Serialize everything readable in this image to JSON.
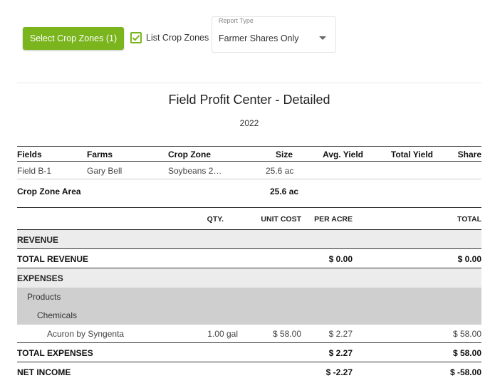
{
  "toolbar": {
    "select_button_label": "Select Crop Zones (1)",
    "list_checkbox_label": "List Crop Zones",
    "list_checked": true,
    "report_type_label": "Report Type",
    "report_type_value": "Farmer Shares Only"
  },
  "report": {
    "title": "Field Profit Center - Detailed",
    "year": "2022"
  },
  "fields_table": {
    "headers": {
      "fields": "Fields",
      "farms": "Farms",
      "crop_zone": "Crop Zone",
      "size": "Size",
      "avg_yield": "Avg. Yield",
      "total_yield": "Total Yield",
      "share": "Share"
    },
    "rows": [
      {
        "field": "Field B-1",
        "farm": "Gary Bell",
        "crop_zone": "Soybeans 2…",
        "size": "25.6 ac"
      }
    ],
    "area_label": "Crop Zone Area",
    "area_value": "25.6 ac"
  },
  "financials": {
    "headers": {
      "qty": "QTY.",
      "unit_cost": "UNIT COST",
      "per_acre": "PER ACRE",
      "total": "TOTAL"
    },
    "revenue_label": "REVENUE",
    "total_revenue": {
      "label": "TOTAL REVENUE",
      "per_acre": "$ 0.00",
      "total": "$ 0.00"
    },
    "expenses_label": "EXPENSES",
    "products_label": "Products",
    "chemicals_label": "Chemicals",
    "items": [
      {
        "name": "Acuron by Syngenta",
        "qty": "1.00 gal",
        "unit_cost": "$ 58.00",
        "per_acre": "$ 2.27",
        "total": "$ 58.00"
      }
    ],
    "total_expenses": {
      "label": "TOTAL EXPENSES",
      "per_acre": "$ 2.27",
      "total": "$ 58.00"
    },
    "net_income": {
      "label": "NET INCOME",
      "per_acre": "$ -2.27",
      "total": "$ -58.00"
    }
  },
  "colors": {
    "accent": "#7ab51d",
    "section_bg": "#ececec",
    "subsection_bg": "#cfcfcf"
  },
  "icons": {
    "checkbox": "check-icon",
    "dropdown": "caret-down-icon"
  }
}
